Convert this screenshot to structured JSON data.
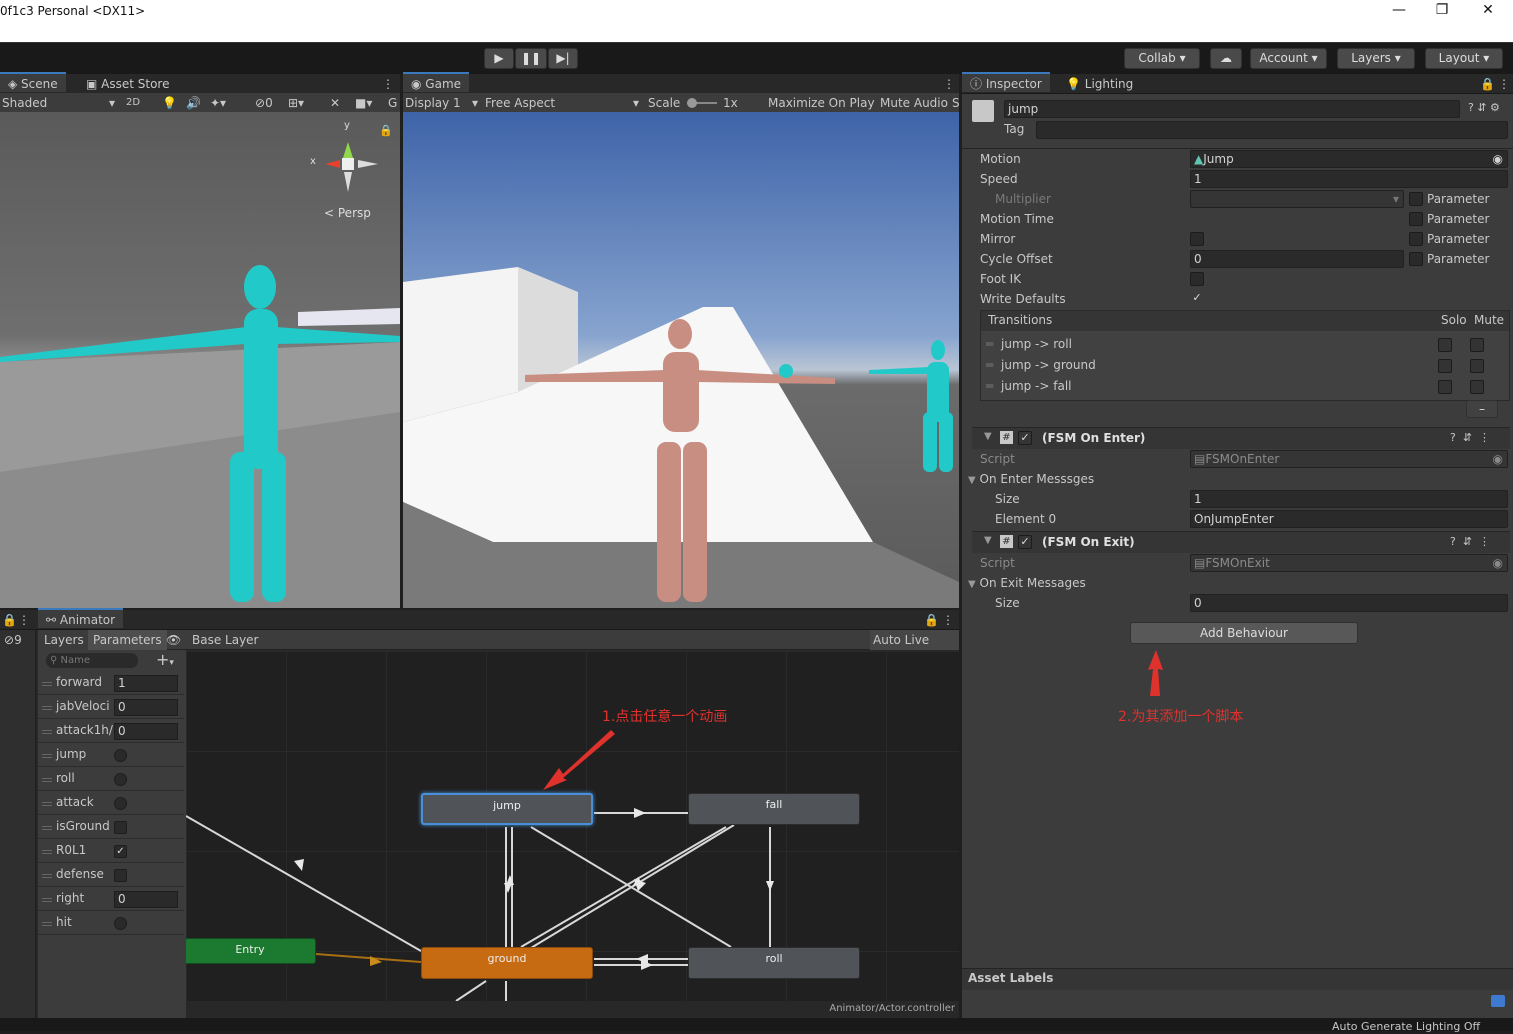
{
  "window": {
    "title": "0f1c3 Personal <DX11>",
    "minimize": "—",
    "maximize": "❐",
    "close": "✕"
  },
  "toolbar": {
    "play": "▶",
    "pause": "❚❚",
    "step": "▶|",
    "collab": "Collab",
    "cloud": "☁",
    "account": "Account",
    "layers": "Layers",
    "layout": "Layout"
  },
  "scene": {
    "tab": "Scene",
    "asset_store_tab": "Asset Store",
    "shading": "Shaded",
    "two_d": "2D",
    "hidden_count": "0",
    "persp": "Persp",
    "gizmo_x": "x",
    "gizmo_y": "y"
  },
  "game": {
    "tab": "Game",
    "display": "Display 1",
    "aspect": "Free Aspect",
    "scale_label": "Scale",
    "scale_value": "1x",
    "maximize": "Maximize On Play",
    "mute": "Mute Audio",
    "stats": "S"
  },
  "inspector": {
    "tab": "Inspector",
    "lighting_tab": "Lighting",
    "name": "jump",
    "tag_label": "Tag",
    "motion_label": "Motion",
    "motion_value": "Jump",
    "speed_label": "Speed",
    "speed_value": "1",
    "multiplier_label": "Multiplier",
    "parameter": "Parameter",
    "motion_time_label": "Motion Time",
    "mirror_label": "Mirror",
    "cycle_offset_label": "Cycle Offset",
    "cycle_offset_value": "0",
    "foot_ik_label": "Foot IK",
    "write_defaults_label": "Write Defaults",
    "transitions_label": "Transitions",
    "solo": "Solo",
    "mute": "Mute",
    "transitions": [
      "jump -> roll",
      "jump -> ground",
      "jump -> fall"
    ],
    "minus": "–",
    "comp1": {
      "title": "(FSM On Enter)",
      "script_label": "Script",
      "script_value": "FSMOnEnter",
      "list_label": "On Enter Messsges",
      "size_label": "Size",
      "size_value": "1",
      "element_label": "Element 0",
      "element_value": "OnJumpEnter"
    },
    "comp2": {
      "title": "(FSM On Exit)",
      "script_label": "Script",
      "script_value": "FSMOnExit",
      "list_label": "On Exit Messages",
      "size_label": "Size",
      "size_value": "0"
    },
    "add_behaviour": "Add Behaviour",
    "asset_labels": "Asset Labels"
  },
  "animator": {
    "tab": "Animator",
    "layers_tab": "Layers",
    "parameters_tab": "Parameters",
    "hidden_count": "9",
    "breadcrumb": "Base Layer",
    "auto_live_link": "Auto Live Link",
    "search_placeholder": "Name",
    "add": "+",
    "params": [
      {
        "name": "forward",
        "type": "float",
        "value": "1"
      },
      {
        "name": "jabVeloci",
        "type": "float",
        "value": "0"
      },
      {
        "name": "attack1h/",
        "type": "float",
        "value": "0"
      },
      {
        "name": "jump",
        "type": "trigger"
      },
      {
        "name": "roll",
        "type": "trigger"
      },
      {
        "name": "attack",
        "type": "trigger"
      },
      {
        "name": "isGround",
        "type": "bool",
        "checked": false
      },
      {
        "name": "R0L1",
        "type": "bool",
        "checked": true
      },
      {
        "name": "defense",
        "type": "bool",
        "checked": false
      },
      {
        "name": "right",
        "type": "float",
        "value": "0"
      },
      {
        "name": "hit",
        "type": "trigger"
      }
    ],
    "nodes": {
      "jump": "jump",
      "fall": "fall",
      "ground": "ground",
      "roll": "roll",
      "entry": "Entry"
    },
    "footer": "Animator/Actor.controller"
  },
  "annotations": {
    "a1": "1.点击任意一个动画",
    "a2": "2.为其添加一个脚本"
  },
  "status": {
    "lighting": "Auto Generate Lighting Off"
  },
  "colors": {
    "accent": "#3a79bb",
    "entry_node": "#1b7a2f",
    "default_state": "#c76b12",
    "annotation": "#e0322c"
  }
}
